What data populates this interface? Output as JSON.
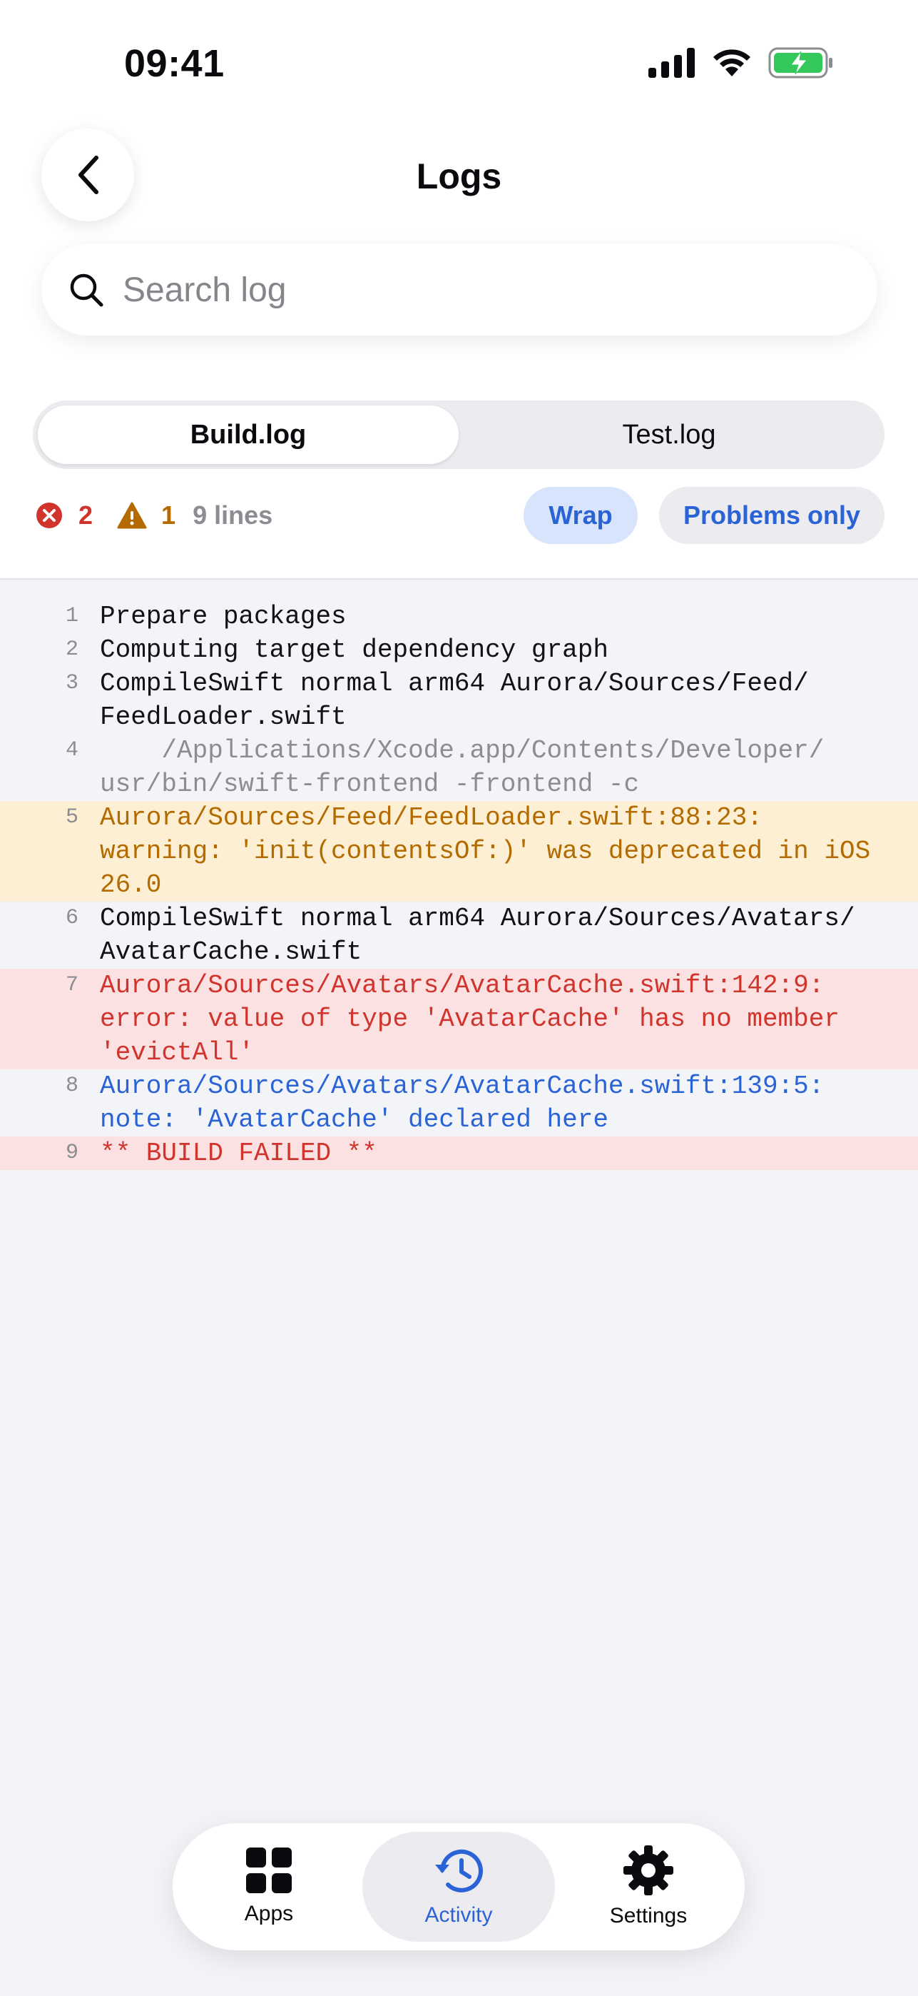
{
  "status_bar": {
    "time": "09:41"
  },
  "header": {
    "title": "Logs"
  },
  "search": {
    "placeholder": "Search log",
    "value": ""
  },
  "tabs": [
    {
      "label": "Build.log",
      "active": true
    },
    {
      "label": "Test.log",
      "active": false
    }
  ],
  "summary": {
    "errors": "2",
    "warnings": "1",
    "lines": "9 lines"
  },
  "filters": {
    "wrap": "Wrap",
    "problems_only": "Problems only"
  },
  "log_lines": [
    {
      "num": "1",
      "text": "Prepare packages",
      "kind": "normal"
    },
    {
      "num": "2",
      "text": "Computing target dependency graph",
      "kind": "normal"
    },
    {
      "num": "3",
      "text": "CompileSwift normal arm64 Aurora/Sources/Feed/\nFeedLoader.swift",
      "kind": "normal"
    },
    {
      "num": "4",
      "text": "    /Applications/Xcode.app/Contents/Developer/\nusr/bin/swift-frontend -frontend -c",
      "kind": "muted"
    },
    {
      "num": "5",
      "text": "Aurora/Sources/Feed/FeedLoader.swift:88:23:\nwarning: 'init(contentsOf:)' was deprecated in iOS\n26.0",
      "kind": "warning"
    },
    {
      "num": "6",
      "text": "CompileSwift normal arm64 Aurora/Sources/Avatars/\nAvatarCache.swift",
      "kind": "normal"
    },
    {
      "num": "7",
      "text": "Aurora/Sources/Avatars/AvatarCache.swift:142:9:\nerror: value of type 'AvatarCache' has no member\n'evictAll'",
      "kind": "error"
    },
    {
      "num": "8",
      "text": "Aurora/Sources/Avatars/AvatarCache.swift:139:5:\nnote: 'AvatarCache' declared here",
      "kind": "note"
    },
    {
      "num": "9",
      "text": "** BUILD FAILED **",
      "kind": "error"
    }
  ],
  "tabbar": [
    {
      "label": "Apps",
      "icon": "grid-icon",
      "active": false
    },
    {
      "label": "Activity",
      "icon": "history-icon",
      "active": true
    },
    {
      "label": "Settings",
      "icon": "gear-icon",
      "active": false
    }
  ],
  "colors": {
    "accent": "#2a63d6",
    "error": "#d0342c",
    "warning": "#b36b00",
    "battery": "#34c759"
  }
}
